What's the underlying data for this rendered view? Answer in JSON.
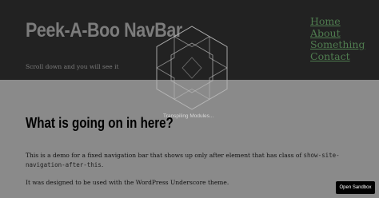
{
  "header": {
    "site_title": "Peek-A-Boo NavBar",
    "site_description": "Scroll down and you will see it"
  },
  "nav": {
    "items": [
      {
        "label": "Home"
      },
      {
        "label": "About"
      },
      {
        "label": "Something"
      },
      {
        "label": "Contact"
      }
    ],
    "link_color": "#4f7c4f"
  },
  "loader": {
    "text": "Transpiling Modules...",
    "icon": "hexagon-spinner-icon"
  },
  "content": {
    "title": "What is going on in here?",
    "p1_before": "This is a demo for a fixed navigation bar that shows up only after element that has class of ",
    "p1_code": "show-site-navigation-after-this",
    "p1_after": ".",
    "p2": "It was designed to be used with the WordPress Underscore theme."
  },
  "sandbox_button": {
    "label": "Open Sandbox"
  },
  "colors": {
    "header_bg": "#222222",
    "overlay_bg": "#8a8a8a"
  }
}
